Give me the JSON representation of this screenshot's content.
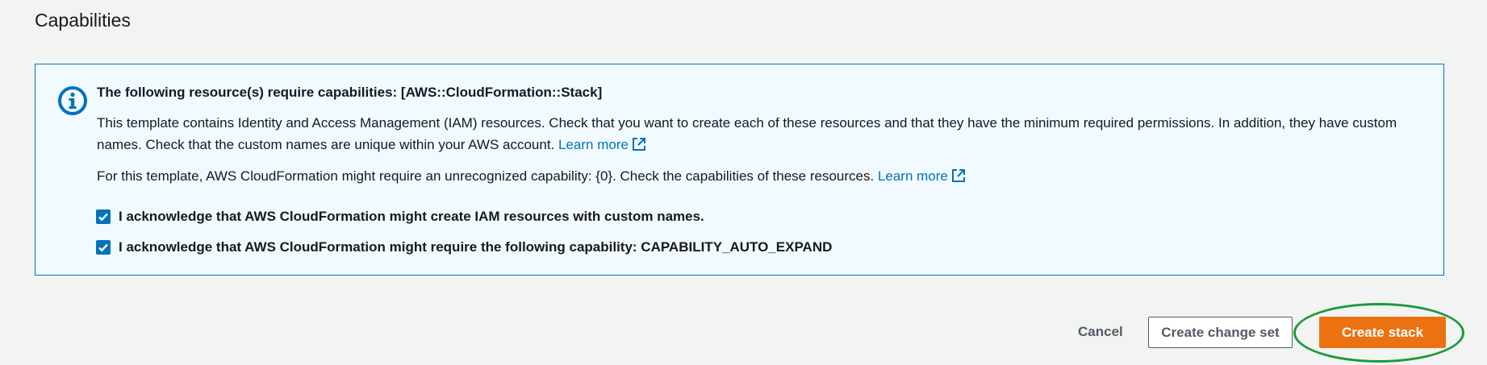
{
  "section": {
    "title": "Capabilities"
  },
  "alert": {
    "title": "The following resource(s) require capabilities: [AWS::CloudFormation::Stack]",
    "para1_text": "This template contains Identity and Access Management (IAM) resources. Check that you want to create each of these resources and that they have the minimum required permissions. In addition, they have custom names. Check that the custom names are unique within your AWS account.",
    "para1_link": "Learn more",
    "para2_text": "For this template, AWS CloudFormation might require an unrecognized capability: {0}. Check the capabilities of these resources.",
    "para2_link": "Learn more",
    "icon": "info-icon"
  },
  "acknowledgements": [
    {
      "label": "I acknowledge that AWS CloudFormation might create IAM resources with custom names.",
      "checked": true
    },
    {
      "label": "I acknowledge that AWS CloudFormation might require the following capability: CAPABILITY_AUTO_EXPAND",
      "checked": true
    }
  ],
  "actions": {
    "cancel_label": "Cancel",
    "change_set_label": "Create change set",
    "create_stack_label": "Create stack"
  },
  "colors": {
    "info_border": "#0073bb",
    "info_background": "#f1faff",
    "link": "#0073bb",
    "primary_button": "#ec7211",
    "highlight_annotation": "#1a9a3a"
  }
}
